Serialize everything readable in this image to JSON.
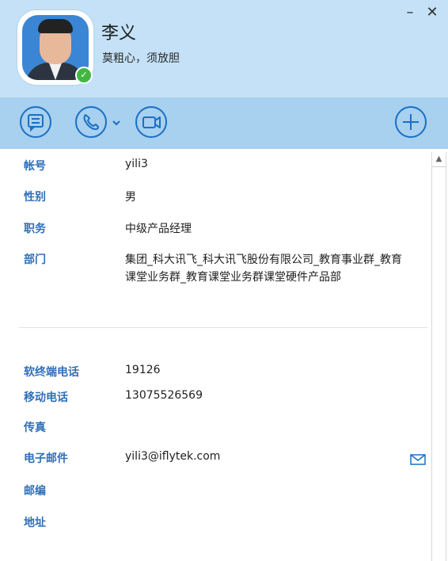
{
  "header": {
    "name": "李义",
    "signature": "莫粗心，须放胆",
    "online_status": "online",
    "minimize_label": "–",
    "close_label": "✕"
  },
  "toolbar": {
    "buttons": [
      {
        "name": "message",
        "icon": "chat-bubble-icon"
      },
      {
        "name": "call",
        "icon": "phone-icon",
        "has_dropdown": true
      },
      {
        "name": "video",
        "icon": "video-camera-icon"
      },
      {
        "name": "add",
        "icon": "plus-icon"
      }
    ]
  },
  "profile": {
    "fields": [
      {
        "label": "帐号",
        "value": "yili3"
      },
      {
        "label": "性别",
        "value": "男"
      },
      {
        "label": "职务",
        "value": "中级产品经理"
      },
      {
        "label": "部门",
        "value": "集团_科大讯飞_科大讯飞股份有限公司_教育事业群_教育课堂业务群_教育课堂业务群课堂硬件产品部"
      }
    ],
    "contact": [
      {
        "label": "软终端电话",
        "value": "19126"
      },
      {
        "label": "移动电话",
        "value": "13075526569"
      },
      {
        "label": "传真",
        "value": ""
      },
      {
        "label": "电子邮件",
        "value": "yili3@iflytek.com"
      },
      {
        "label": "邮编",
        "value": ""
      },
      {
        "label": "地址",
        "value": ""
      }
    ]
  },
  "colors": {
    "header_bg": "#c4e1f7",
    "toolbar_bg": "#a8d0ef",
    "icon_blue": "#1a6fc4",
    "label_blue": "#2f6fb8",
    "online_green": "#3fb843"
  }
}
